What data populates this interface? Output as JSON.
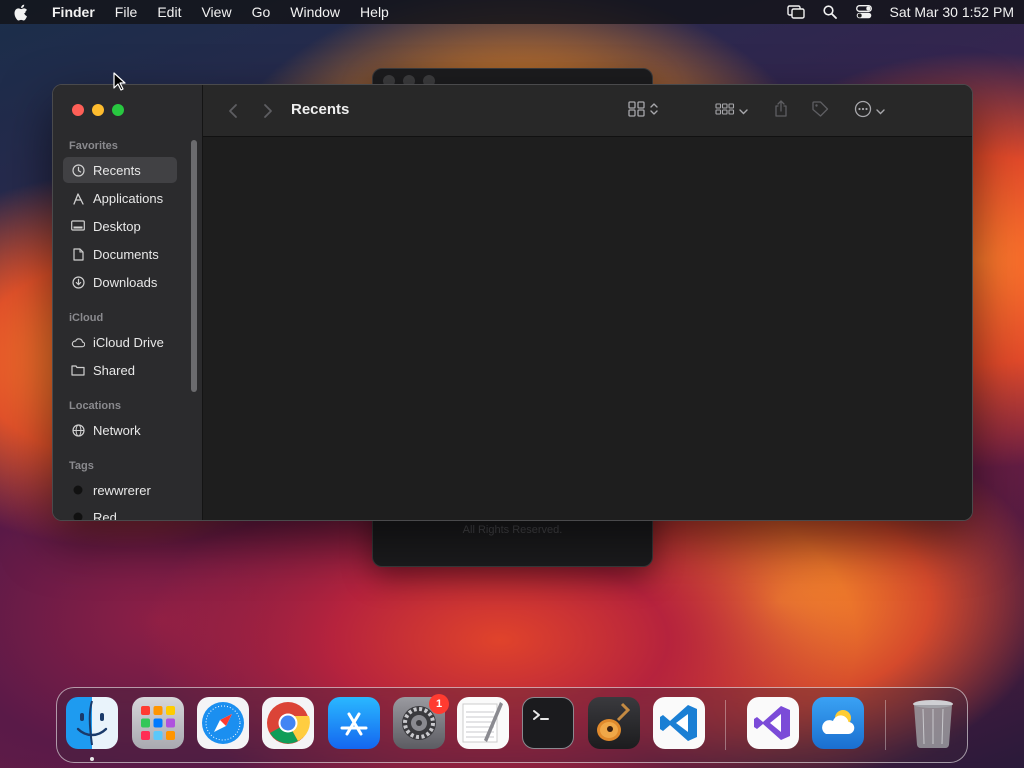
{
  "menubar": {
    "app_name": "Finder",
    "items": [
      "File",
      "Edit",
      "View",
      "Go",
      "Window",
      "Help"
    ],
    "status_icons": [
      "screen-mirroring-icon",
      "spotlight-search-icon",
      "control-center-icon"
    ],
    "clock": "Sat Mar 30  1:52 PM"
  },
  "background_window": {
    "footer_text": "All Rights Reserved."
  },
  "finder": {
    "title": "Recents",
    "sidebar": {
      "favorites_header": "Favorites",
      "favorites": [
        "Recents",
        "Applications",
        "Desktop",
        "Documents",
        "Downloads"
      ],
      "icloud_header": "iCloud",
      "icloud": [
        "iCloud Drive",
        "Shared"
      ],
      "locations_header": "Locations",
      "locations": [
        "Network"
      ],
      "tags_header": "Tags",
      "tags": [
        "rewwrerer",
        "Red"
      ],
      "selected": "Recents"
    }
  },
  "dock": {
    "apps": [
      {
        "name": "Finder",
        "running": true
      },
      {
        "name": "Launchpad"
      },
      {
        "name": "Safari"
      },
      {
        "name": "Google Chrome"
      },
      {
        "name": "App Store"
      },
      {
        "name": "System Settings",
        "badge": "1"
      },
      {
        "name": "TextEdit"
      },
      {
        "name": "Terminal"
      },
      {
        "name": "GarageBand"
      },
      {
        "name": "Visual Studio Code"
      },
      {
        "name": "Visual Studio"
      },
      {
        "name": "Weather"
      },
      {
        "name": "Trash"
      }
    ]
  }
}
